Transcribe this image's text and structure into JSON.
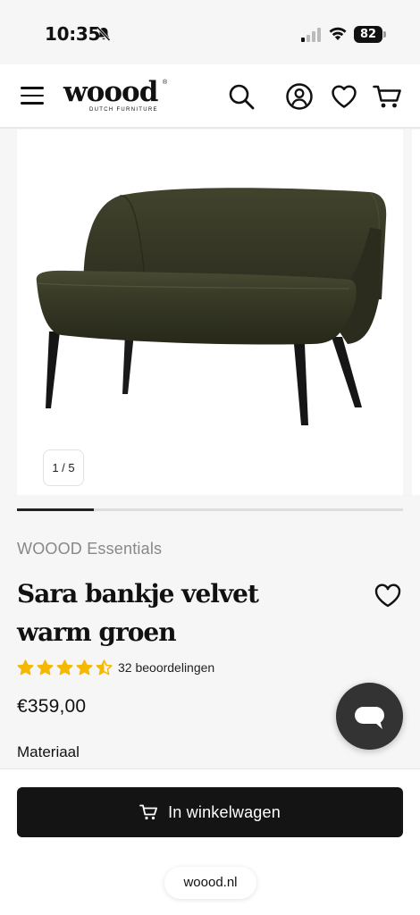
{
  "status_bar": {
    "time": "10:35",
    "battery": "82"
  },
  "header": {
    "logo_text": "woood",
    "logo_subtitle": "DUTCH FURNITURE"
  },
  "gallery": {
    "counter": "1 / 5",
    "progress": 0.2
  },
  "product": {
    "brand": "WOOOD Essentials",
    "title": "Sara bankje velvet warm groen",
    "rating": 4.5,
    "reviews_label": "32 beoordelingen",
    "price": "€359,00",
    "section_label": "Materiaal",
    "color": "#3b3d2a"
  },
  "cart": {
    "label": "In winkelwagen"
  },
  "browser": {
    "url": "woood.nl"
  },
  "icons": {
    "bell": "bell-muted-icon",
    "menu": "hamburger-icon",
    "search": "search-icon",
    "account": "account-icon",
    "wishlist": "heart-icon",
    "cart": "cart-icon",
    "chat": "chat-icon",
    "star": "star-icon"
  },
  "colors": {
    "star": "#f5b800",
    "cta_background": "#141414",
    "chat_background": "#333333"
  }
}
